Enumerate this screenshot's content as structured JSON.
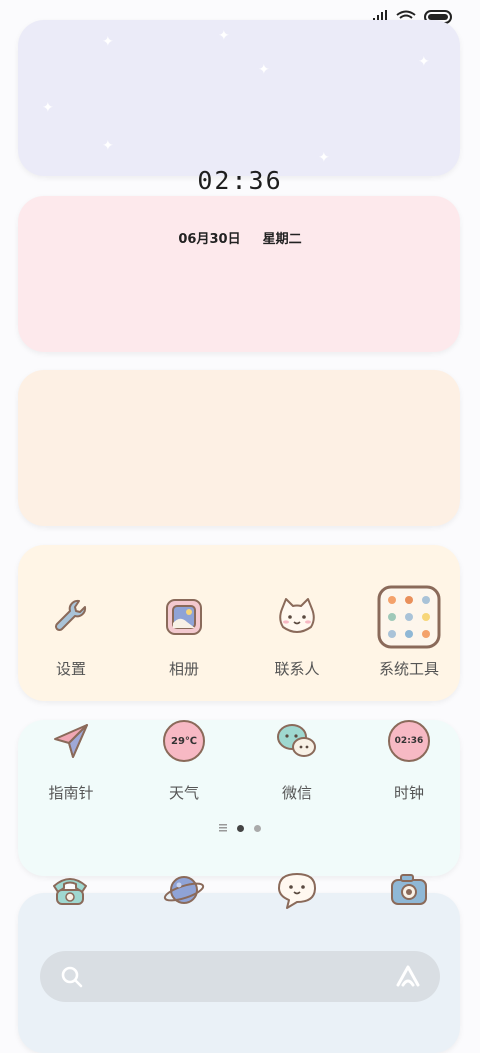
{
  "clock": {
    "time": "02:36"
  },
  "date": {
    "day": "06月30日",
    "weekday": "星期二"
  },
  "apps_row1": [
    {
      "label": "设置",
      "icon": "wrench-icon"
    },
    {
      "label": "相册",
      "icon": "photo-album-icon"
    },
    {
      "label": "联系人",
      "icon": "cat-face-icon"
    },
    {
      "label": "系统工具",
      "icon": "folder-grid-icon"
    }
  ],
  "apps_row2": [
    {
      "label": "指南针",
      "icon": "paper-plane-icon"
    },
    {
      "label": "天气",
      "icon": "weather-badge-icon",
      "badge": "29℃"
    },
    {
      "label": "微信",
      "icon": "chat-bubbles-icon"
    },
    {
      "label": "时钟",
      "icon": "clock-badge-icon",
      "badge": "02:36"
    }
  ],
  "page_indicator": {
    "pages": 2,
    "current": 1
  },
  "dock": [
    {
      "icon": "telephone-icon"
    },
    {
      "icon": "planet-icon"
    },
    {
      "icon": "message-bubble-icon"
    },
    {
      "icon": "camera-icon"
    }
  ],
  "colors": {
    "card1": "#ebebf8",
    "card2": "#fde9ec",
    "card3": "#fdf0e4",
    "card4": "#fff5e6",
    "card5": "#f1fbfa",
    "card6": "#eaf1f7",
    "icon_stroke": "#8a6a5a",
    "badge_pink": "#f7b9c4"
  }
}
